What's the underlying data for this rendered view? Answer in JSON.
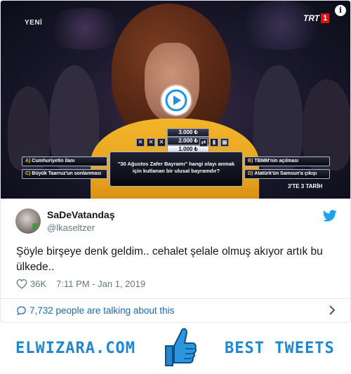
{
  "video": {
    "channel_left": "YENİ",
    "channel_logo_text": "TRT",
    "channel_logo_number": "1",
    "info_icon_glyph": "i",
    "play_icon": "play-icon",
    "quiz": {
      "money_ladder": [
        "3.000 ₺",
        "2.000 ₺",
        "1.000 ₺"
      ],
      "lifelines_left": [
        "✕",
        "✕",
        "✕"
      ],
      "lifelines_right": [
        "⇄",
        "▮",
        "▦"
      ],
      "question": "\"30 Ağustos Zafer Bayramı\" hangi olayı anmak için kutlanan bir ulusal bayramdır?",
      "answers": [
        {
          "letter": "A)",
          "text": "Cumhuriyetin ilanı"
        },
        {
          "letter": "B)",
          "text": "TBMM'nin açılması"
        },
        {
          "letter": "C)",
          "text": "Büyük Taarruz'un sonlanması"
        },
        {
          "letter": "D)",
          "text": "Atatürk'ün Samsun'a çıkışı"
        }
      ],
      "date_tag": "3'TE 3 TARİH"
    }
  },
  "tweet": {
    "display_name": "SaDeVatandaş",
    "handle": "@lkaseltzer",
    "text": "Şöyle birşeye denk geldim.. cehalet şelale olmuş akıyor artık bu ülkede..",
    "likes": "36K",
    "timestamp": "7:11 PM - Jan 1, 2019",
    "talking": "7,732 people are talking about this"
  },
  "footer": {
    "site": "ELWIZARA.COM",
    "tagline": "BEST TWEETS"
  },
  "colors": {
    "twitter_blue": "#1da1f2",
    "link_blue": "#1b6aa8",
    "brand_blue": "#1f86cf",
    "quiz_gold": "#f1c44c",
    "sweater_yellow": "#e8a11c"
  }
}
